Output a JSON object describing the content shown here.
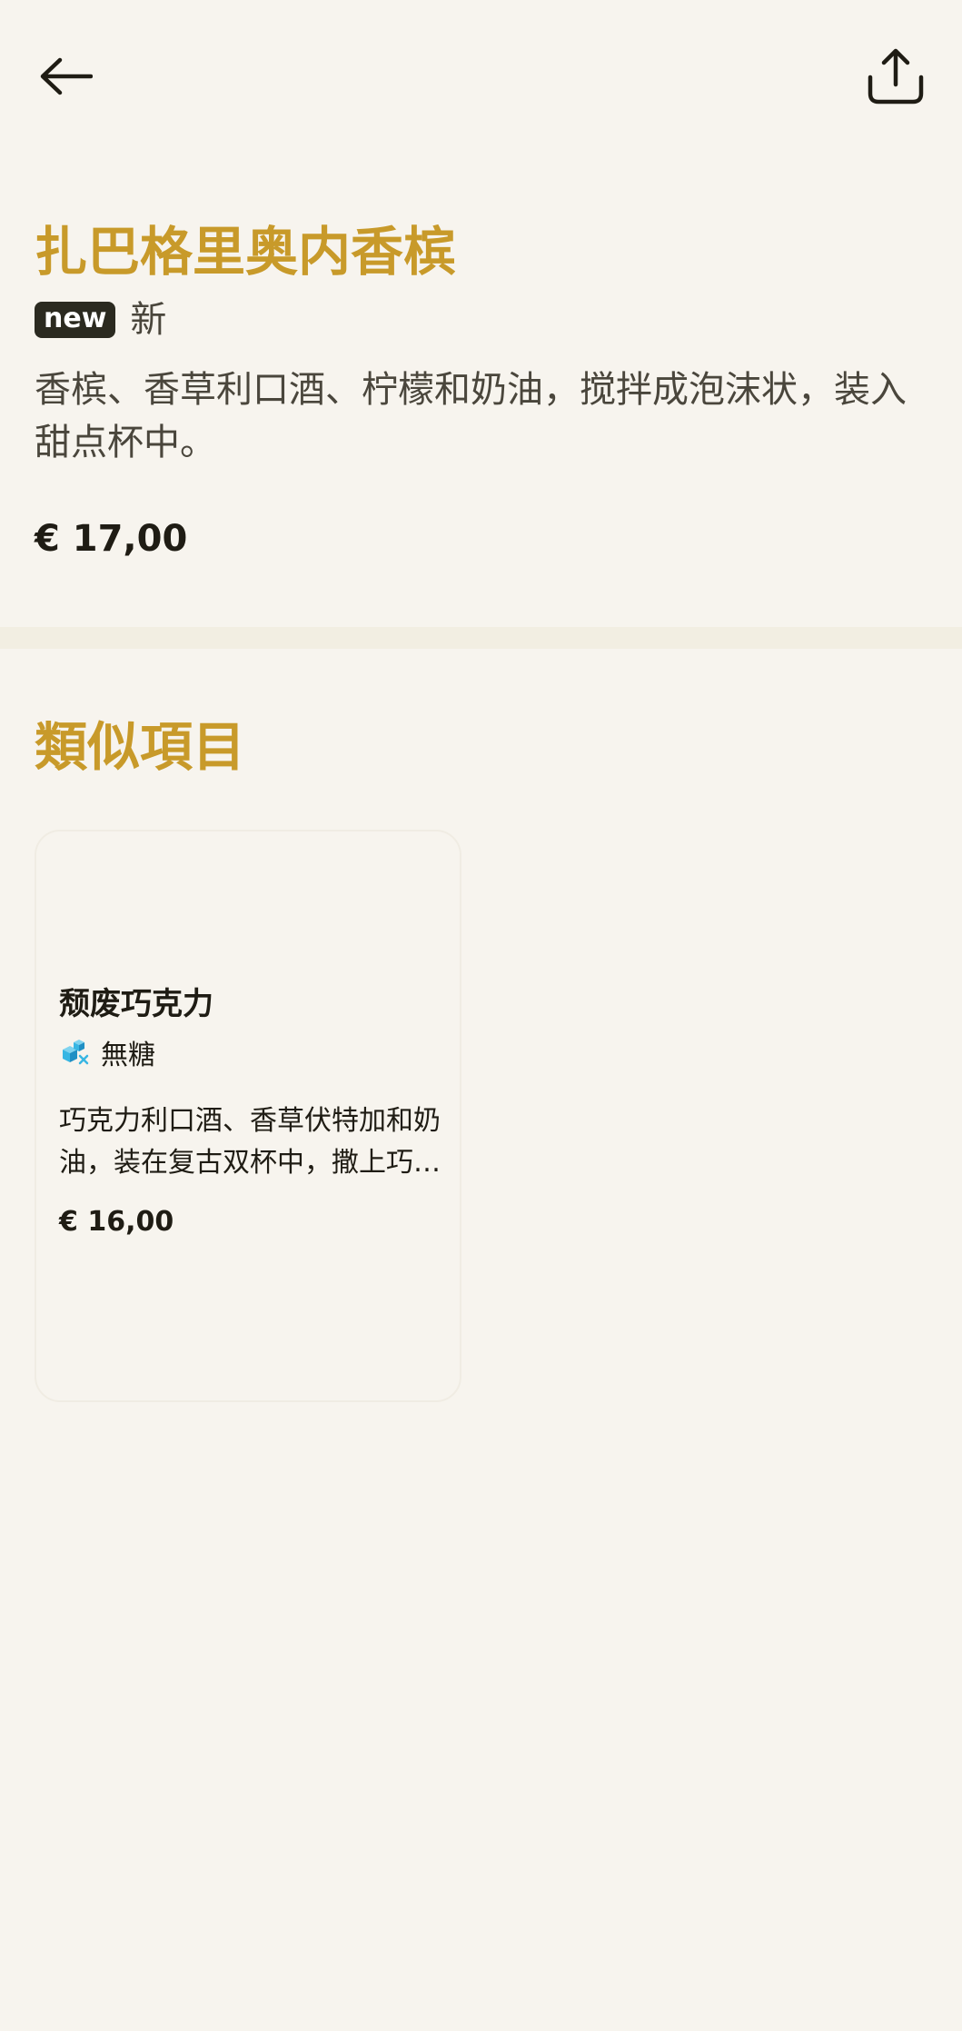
{
  "header": {
    "back_icon": "arrow-left-icon",
    "share_icon": "share-upload-icon"
  },
  "item": {
    "title": "扎巴格里奥内香槟",
    "badge": "new",
    "badge_text": "新",
    "description": "香槟、香草利口酒、柠檬和奶油，搅拌成泡沫状，装入甜点杯中。",
    "price": "€ 17,00"
  },
  "similar": {
    "title": "類似項目",
    "items": [
      {
        "title": "颓废巧克力",
        "tag_icon": "sugar-free-icon",
        "tag_label": "無糖",
        "description": "巧克力利口酒、香草伏特加和奶油，装在复古双杯中，撒上巧…",
        "price": "€ 16,00"
      }
    ]
  },
  "colors": {
    "background": "#f7f4ee",
    "accent": "#c89a2a",
    "text": "#1f1c14",
    "badge_bg": "#2b2a20",
    "icon_blue": "#38b6e3"
  }
}
